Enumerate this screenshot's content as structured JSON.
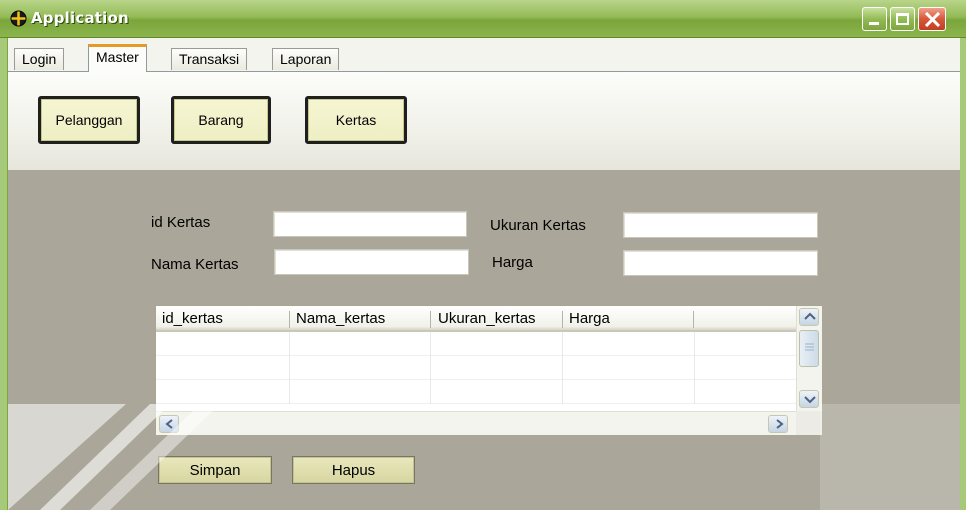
{
  "window": {
    "title": "Application",
    "buttons": {
      "minimize": "minimize",
      "maximize": "maximize",
      "close": "close"
    }
  },
  "tabs": [
    {
      "label": "Login",
      "active": false
    },
    {
      "label": "Master",
      "active": true
    },
    {
      "label": "Transaksi",
      "active": false
    },
    {
      "label": "Laporan",
      "active": false
    }
  ],
  "master_buttons": {
    "pelanggan": "Pelanggan",
    "barang": "Barang",
    "kertas": "Kertas"
  },
  "form": {
    "id_kertas": {
      "label": "id Kertas",
      "value": ""
    },
    "nama_kertas": {
      "label": "Nama Kertas",
      "value": ""
    },
    "ukuran_kertas": {
      "label": "Ukuran Kertas",
      "value": ""
    },
    "harga": {
      "label": "Harga",
      "value": ""
    }
  },
  "grid": {
    "columns": [
      "id_kertas",
      "Nama_kertas",
      "Ukuran_kertas",
      "Harga"
    ],
    "rows": []
  },
  "actions": {
    "simpan": "Simpan",
    "hapus": "Hapus"
  },
  "colors": {
    "titlebar": "#94bb57",
    "form_background": "#aaa79a",
    "button_face": "#efefc4",
    "active_tab_accent": "#e69b28",
    "close_button": "#d8573a"
  }
}
